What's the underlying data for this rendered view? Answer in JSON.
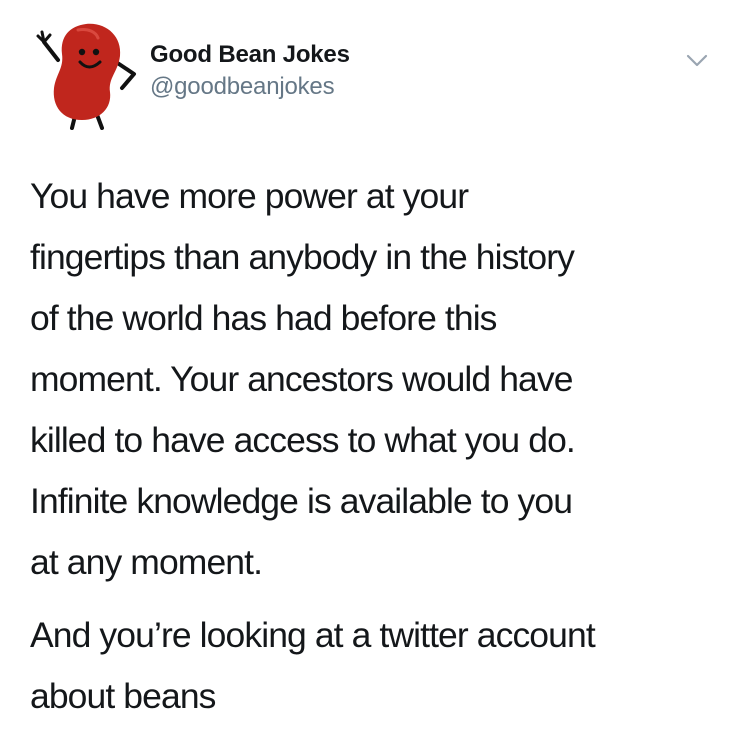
{
  "tweet": {
    "author": {
      "display_name": "Good Bean Jokes",
      "handle": "@goodbeanjokes",
      "avatar_icon": "kidney-bean-mascot-icon",
      "avatar_color": "#c0261d"
    },
    "menu_icon": "chevron-down-icon",
    "paragraphs": [
      {
        "lines": [
          "You have more power at your",
          "fingertips than anybody in the history",
          "of the world has had before this",
          "moment. Your ancestors would have",
          "killed to have access to what you do.",
          "Infinite knowledge is available to you",
          "at any moment."
        ]
      },
      {
        "lines": [
          "And you’re looking at a twitter account",
          "about beans"
        ]
      }
    ]
  },
  "colors": {
    "text_primary": "#14171a",
    "text_secondary": "#657786",
    "background": "#ffffff"
  }
}
